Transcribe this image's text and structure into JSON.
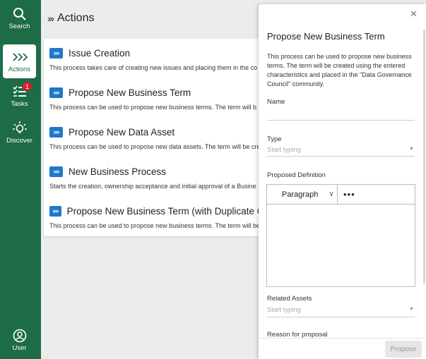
{
  "rail": {
    "search": "Search",
    "actions": "Actions",
    "tasks": "Tasks",
    "tasks_badge": "1",
    "discover": "Discover",
    "user": "User"
  },
  "main": {
    "title": "Actions",
    "actions": [
      {
        "title": "Issue Creation",
        "desc": "This process takes care of creating new issues and placing them in the co"
      },
      {
        "title": "Propose New Business Term",
        "desc": "This process can be used to propose new business terms. The term will b"
      },
      {
        "title": "Propose New Data Asset",
        "desc": "This process can be used to propose new data assets. The term will be cre"
      },
      {
        "title": "New Business Process",
        "desc": "Starts the creation, ownership acceptance and initial approval of a Busine"
      },
      {
        "title": "Propose New Business Term (with Duplicate Check",
        "desc": "This process can be used to propose new business terms. The term will be"
      }
    ]
  },
  "panel": {
    "title": "Propose New Business Term",
    "description": "This process can be used to propose new business terms. The term will be created using the entered characteristics and placed in the \"Data Governance Council\" community.",
    "name_label": "Name",
    "type_label": "Type",
    "type_placeholder": "Start typing",
    "definition_label": "Proposed Definition",
    "paragraph_label": "Paragraph",
    "related_label": "Related Assets",
    "related_placeholder": "Start typing",
    "reason_label": "Reason for proposal",
    "propose_button": "Propose"
  },
  "colors": {
    "rail": "#1d6b47",
    "accent": "#1f78c9",
    "badge": "#d7212f"
  },
  "icons": [
    "search-icon",
    "actions-chevrons-icon",
    "tasks-list-icon",
    "discover-bulb-icon",
    "user-icon",
    "close-icon",
    "dropdown-caret-icon",
    "more-icon"
  ]
}
